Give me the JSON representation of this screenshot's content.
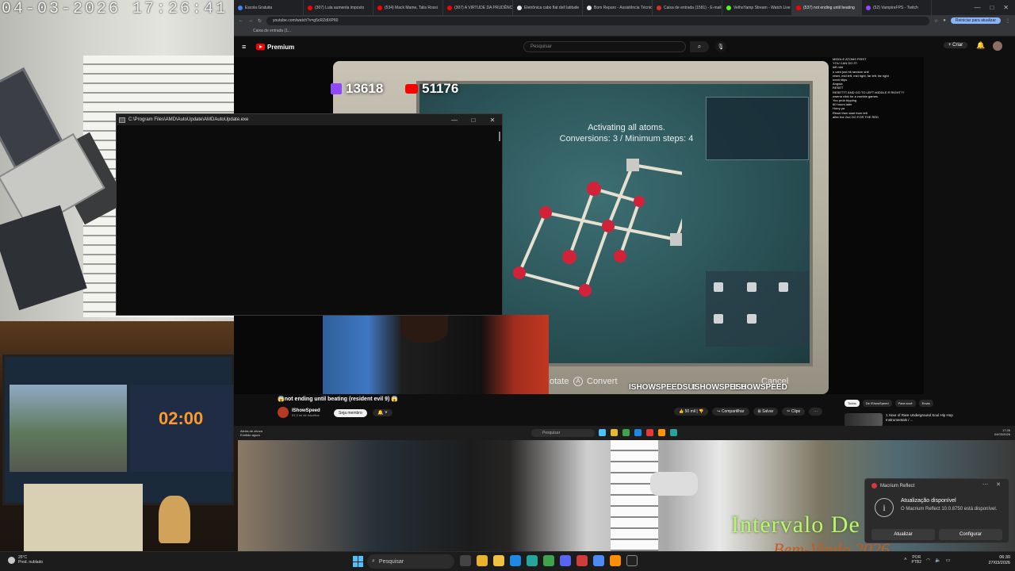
{
  "camera": {
    "timestamp": "04-03-2026  17:26:41",
    "timer": "02:00",
    "overlay_title": "Intervalo De",
    "overlay_subtitle": "Bem-Vindo 2026"
  },
  "browser": {
    "tabs": [
      {
        "label": "Escola Gratuita",
        "color": "#4285f4"
      },
      {
        "label": "(307) Lula aumenta imposto",
        "color": "#ff0000"
      },
      {
        "label": "(534) Mack Mame, Talis Rossi",
        "color": "#ff0000"
      },
      {
        "label": "(307) A VIRTUDE DA PRUDÊNCIA",
        "color": "#ff0000"
      },
      {
        "label": "Eletrônica cabo flat dell latitude",
        "color": "#e8eaed"
      },
      {
        "label": "Bom Reparo - Assistência Técnica",
        "color": "#e8eaed"
      },
      {
        "label": "Caixa de entrada (1581) - E-mail",
        "color": "#d93025"
      },
      {
        "label": "VelhoYamp Stream - Watch Live",
        "color": "#53fc18"
      },
      {
        "label": "(537) not ending until beating",
        "color": "#ff0000",
        "active": true
      },
      {
        "label": "(52) VampireFPS - Twitch",
        "color": "#9146ff"
      }
    ],
    "url": "youtube.com/watch?v=g5cRZdIXP60",
    "update_button": "Reiniciar para atualizar",
    "bookmark": "Caixa de entrada (1..."
  },
  "youtube": {
    "logo_text": "Premium",
    "search_placeholder": "Pesquisar",
    "create_label": "Criar",
    "video_title": "not ending until beating (resident evil 9)",
    "channel_name": "IShowSpeed",
    "subscribers": "51,3 mi de inscritos",
    "member_button": "Seja membro",
    "likes": "50 mil",
    "share_label": "Compartilhar",
    "save_label": "Salvar",
    "clip_label": "Clipe",
    "chips": [
      {
        "label": "Todos",
        "active": true
      },
      {
        "label": "De IShowSpeed"
      },
      {
        "label": "Para você"
      },
      {
        "label": "Envia"
      }
    ],
    "rec_title": "1 Hour of Rare Underground Soul Hip Hop Instrumentals / ..."
  },
  "stream": {
    "twitch_count": "13618",
    "youtube_count": "51176",
    "puzzle_line1": "Activating all atoms.",
    "puzzle_line2": "Conversions: 3 / Minimum steps: 4",
    "controls": {
      "rotate": "otate",
      "convert": "Convert",
      "cancel": "Cancel",
      "convert_key": "A"
    },
    "socials": [
      "ISHOWSPEEDSUI",
      "ISHOWSPEED",
      "ISHOWSPEED"
    ],
    "chat": [
      {
        "nick": "",
        "text": "MIDDLE ATOMS FIRST"
      },
      {
        "nick": "",
        "text": "YOU CAN DO IT!"
      },
      {
        "nick": "",
        "text": "left mid"
      },
      {
        "nick": "",
        "text": "u cant just hit random shit"
      },
      {
        "nick": "",
        "text": "reset, mid left, mid right, far left, far right"
      },
      {
        "nick": "",
        "text": "need stips"
      },
      {
        "nick": "",
        "text": "Angola"
      },
      {
        "nick": "",
        "text": "RESET"
      },
      {
        "nick": "",
        "text": "RESETTT AND GO TO LEFT MIDDLE R RIGHT??"
      },
      {
        "nick": "",
        "text": "owena click for a zombie games"
      },
      {
        "nick": "",
        "text": "You prob tripping"
      },
      {
        "nick": "",
        "text": "60 hours later"
      },
      {
        "nick": "",
        "text": "Hurry ya"
      },
      {
        "nick": "",
        "text": "Reset then start from left"
      },
      {
        "nick": "",
        "text": "after the 2nd GO FOR THE RED"
      }
    ]
  },
  "inner_taskbar": {
    "weather": "Alerta de chuva",
    "weather_sub": "Emitido agora",
    "search": "Pesquisar",
    "time": "17:26",
    "date": "04/03/2026"
  },
  "console": {
    "title": "C:\\Program Files\\AMD\\AutoUpdate\\AMDAutoUpdate.exe"
  },
  "toast": {
    "app": "Macrium Reflect",
    "title": "Atualização disponível",
    "body": "O Macrium Reflect 10.0.8750 está disponível.",
    "primary": "Atualizar",
    "secondary": "Configurar"
  },
  "taskbar": {
    "temperature": "26°C",
    "weather": "Pred. nublado",
    "search": "Pesquisar",
    "lang1": "POR",
    "lang2": "PTB2",
    "time": "06:30",
    "date": "27/03/2026"
  }
}
